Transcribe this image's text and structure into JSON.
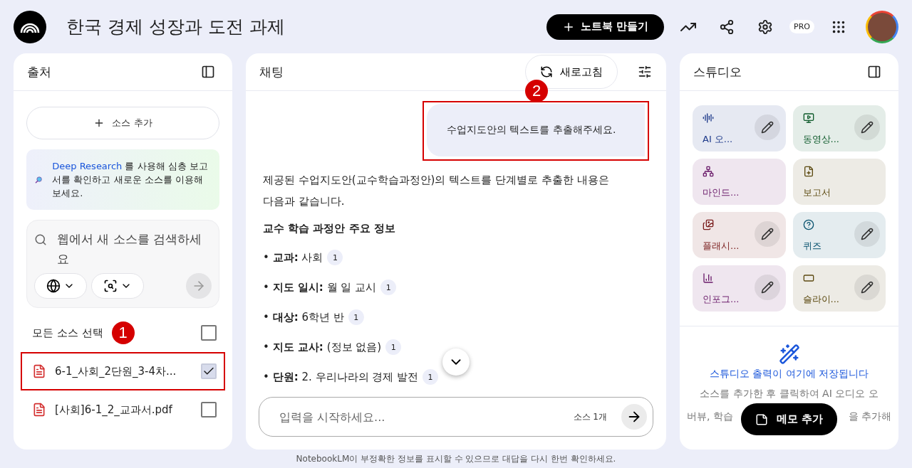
{
  "header": {
    "title": "한국 경제 성장과 도전 과제",
    "create_button": "노트북 만들기",
    "pro_badge": "PRO"
  },
  "sources": {
    "title": "출처",
    "add_button": "소스 추가",
    "promo": {
      "link": "Deep Research",
      "text": "를 사용해 심층 보고서를 확인하고 새로운 소스를 이용해 보세요."
    },
    "search": {
      "placeholder": "웹에서 새 소스를 검색하세요"
    },
    "select_all": {
      "label": "모든 소스 선택",
      "checked": false
    },
    "items": [
      {
        "name": "6-1_사회_2단원_3-4차...",
        "checked": true,
        "highlighted": true
      },
      {
        "name": "[사회]6-1_2_교과서.pdf",
        "checked": false,
        "highlighted": false
      }
    ]
  },
  "chat": {
    "title": "채팅",
    "refresh_button": "새로고침",
    "user_message": {
      "text": "수업지도안의 텍스트를 추출해주세요.",
      "highlighted": true
    },
    "intro": "제공된 수업지도안(교수학습과정안)의 텍스트를 단계별로 추출한 내용은 다음과 같습니다.",
    "heading": "교수 학습 과정안 주요 정보",
    "facts": [
      {
        "bullet": "•",
        "label": "교과:",
        "value": "사회",
        "citation": "1"
      },
      {
        "bullet": "•",
        "label": "지도 일시:",
        "value": "월 일 교시",
        "citation": "1"
      },
      {
        "bullet": "•",
        "label": "대상:",
        "value": "6학년 반",
        "citation": "1"
      },
      {
        "bullet": "•",
        "label": "지도 교사:",
        "value": "(정보 없음)",
        "citation": "1"
      },
      {
        "bullet": "•",
        "label": "단원:",
        "value": "2. 우리나라의 경제 발전",
        "citation": "1"
      }
    ],
    "input": {
      "placeholder": "입력을 시작하세요...",
      "source_count": "소스 1개"
    }
  },
  "studio": {
    "title": "스튜디오",
    "tiles": [
      {
        "kind": "audio",
        "label": "AI 오...",
        "color": "#1e3a8a",
        "editable": true
      },
      {
        "kind": "video",
        "label": "동영상...",
        "color": "#0d5a2a",
        "editable": true
      },
      {
        "kind": "mindmap",
        "label": "마인드...",
        "color": "#6a1b6a",
        "editable": false
      },
      {
        "kind": "report",
        "label": "보고서",
        "color": "#5c4a10",
        "editable": false
      },
      {
        "kind": "flashcards",
        "label": "플래시...",
        "color": "#7a1e1e",
        "editable": true
      },
      {
        "kind": "quiz",
        "label": "퀴즈",
        "color": "#0b5470",
        "editable": true
      },
      {
        "kind": "infographic",
        "label": "인포그...",
        "color": "#6a1b6a",
        "editable": true
      },
      {
        "kind": "slides",
        "label": "슬라이...",
        "color": "#5c4a10",
        "editable": true
      }
    ],
    "empty_title": "스튜디오 출력이 여기에 저장됩니다",
    "empty_lines": [
      "소스를 추가한 후 클릭하여 AI 오디오 오",
      "버뷰, 학습",
      "을 추가해"
    ],
    "memo_button": "메모 추가"
  },
  "annotations": [
    {
      "number": "1"
    },
    {
      "number": "2"
    }
  ],
  "footer": "NotebookLM이 부정확한 정보를 표시할 수 있으므로 대답을 다시 한번 확인하세요."
}
